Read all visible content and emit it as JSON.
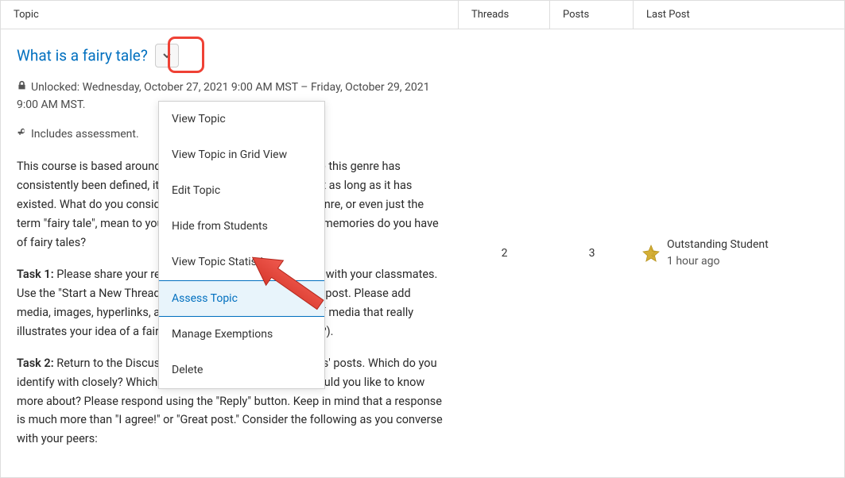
{
  "header": {
    "topic": "Topic",
    "threads": "Threads",
    "posts": "Posts",
    "lastpost": "Last Post"
  },
  "topic": {
    "title": "What is a fairy tale?",
    "unlocked_text": "Unlocked: Wednesday, October 27, 2021 9:00 AM MST – Friday, October 29, 2021 9:00 AM MST.",
    "assessment_text": "Includes assessment.",
    "intro": "This course is based around the genre of the fairy tale. While this genre has consistently been defined, it has also been contested for just as long as it has existed. What do you consider a fairy tale? What does the genre, or even just the term \"fairy tale\", mean to you? What associated images and memories do you have of fairy tales?",
    "task1_label": "Task 1:",
    "task1_text": " Please share your responses to the questions above with your classmates. Use the \"Start a New Thread\" button above to compose your post. Please add media, images, hyperlinks, audio, or video (is there a piece of media that really illustrates your idea of a fairy tale, or that clashes with them?).",
    "task2_label": "Task 2:",
    "task2_text": " Return to the Discussion and peruse your classmates' posts. Which do you identify with closely? Which do you disagree with? Which would you like to know more about? Please respond using the \"Reply\" button. Keep in mind that a response is much more than \"I agree!\" or \"Great post.\" Consider the following as you converse with your peers:"
  },
  "menu": {
    "items": [
      "View Topic",
      "View Topic in Grid View",
      "Edit Topic",
      "Hide from Students",
      "View Topic Statistics",
      "Assess Topic",
      "Manage Exemptions",
      "Delete"
    ],
    "highlighted_index": 5
  },
  "stats": {
    "threads": "2",
    "posts": "3"
  },
  "lastpost": {
    "author": "Outstanding Student",
    "time": "1 hour ago"
  }
}
